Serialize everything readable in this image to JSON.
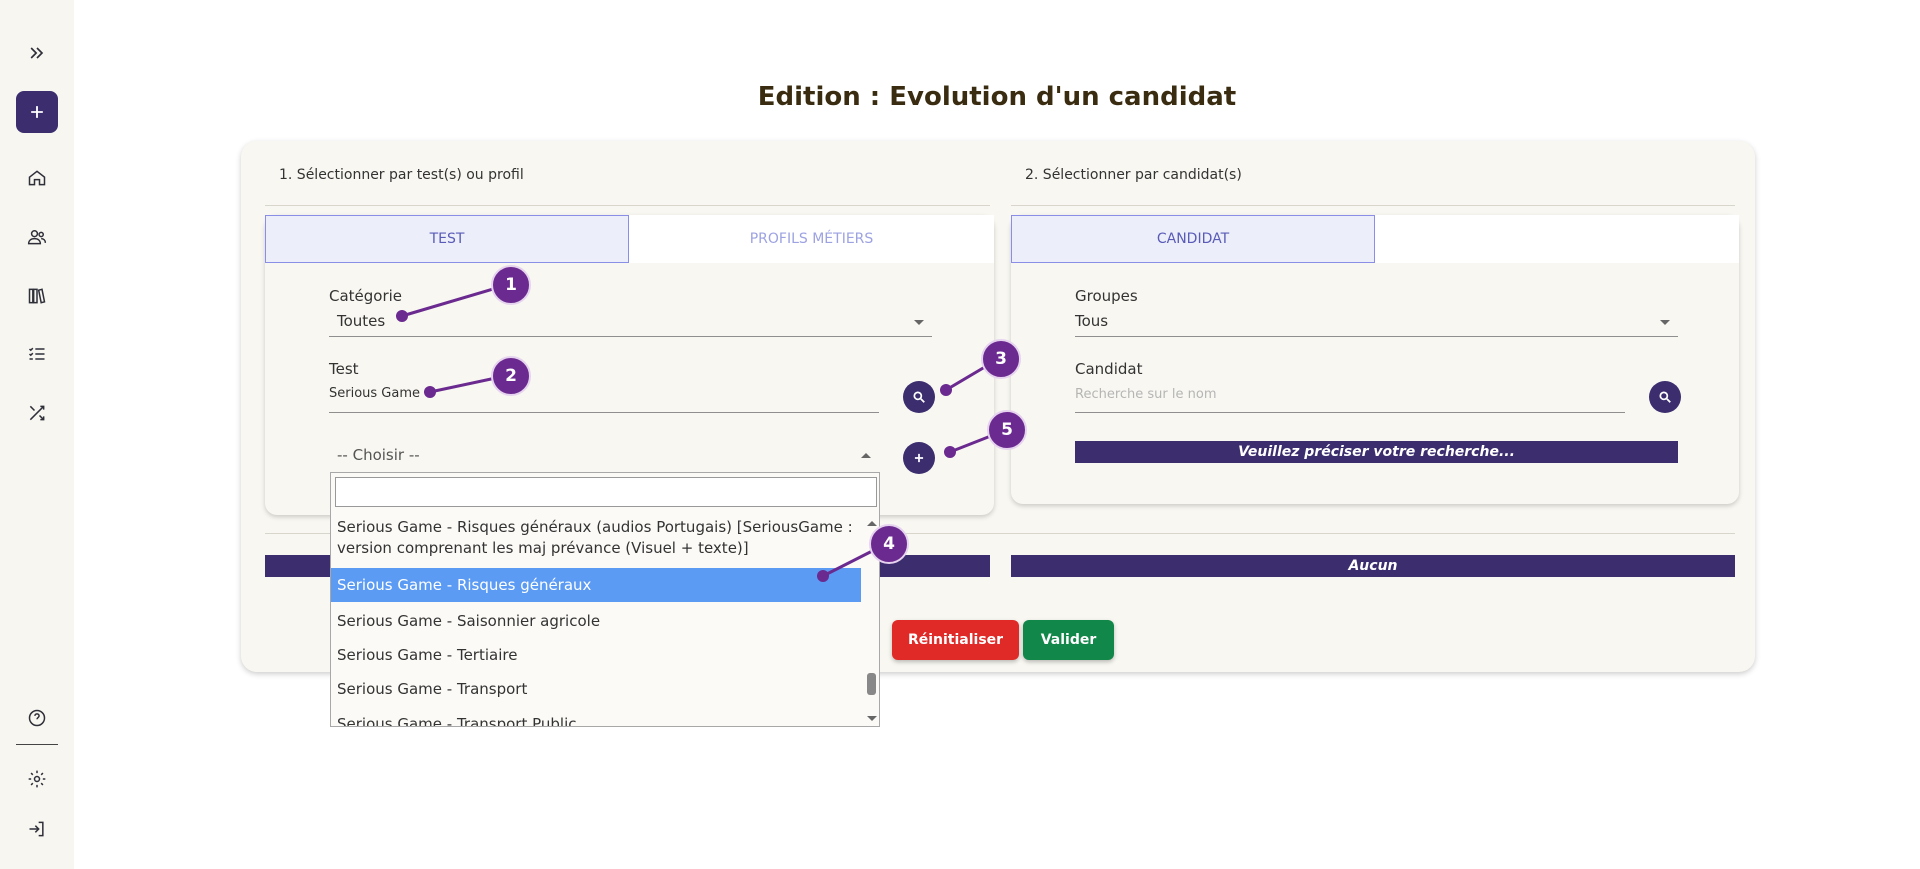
{
  "page": {
    "title": "Edition : Evolution d'un candidat"
  },
  "sidebar": {
    "items": [
      {
        "icon": "expand-icon"
      },
      {
        "icon": "plus-icon"
      },
      {
        "icon": "home-icon"
      },
      {
        "icon": "users-icon"
      },
      {
        "icon": "library-icon"
      },
      {
        "icon": "checklist-icon"
      },
      {
        "icon": "shuffle-icon"
      },
      {
        "icon": "help-icon"
      },
      {
        "icon": "settings-icon"
      },
      {
        "icon": "logout-icon"
      }
    ]
  },
  "left": {
    "section_title": "1. Sélectionner par test(s) ou profil",
    "tabs": [
      {
        "label": "TEST",
        "active": true
      },
      {
        "label": "PROFILS MÉTIERS",
        "active": false
      }
    ],
    "categorie": {
      "label": "Catégorie",
      "value": "Toutes"
    },
    "test": {
      "label": "Test",
      "value": "Serious Game"
    },
    "select": {
      "value": "-- Choisir --"
    },
    "dropdown": {
      "search_value": "",
      "items": [
        {
          "label": "Serious Game - Risques généraux (audios Portugais) [SeriousGame : version comprenant les maj prévance (Visuel + texte)]",
          "selected": false
        },
        {
          "label": "Serious Game - Risques généraux",
          "selected": true
        },
        {
          "label": "Serious Game - Saisonnier agricole",
          "selected": false
        },
        {
          "label": "Serious Game - Tertiaire",
          "selected": false
        },
        {
          "label": "Serious Game - Transport",
          "selected": false
        },
        {
          "label": "Serious Game - Transport Public",
          "selected": false
        }
      ]
    }
  },
  "right": {
    "section_title": "2. Sélectionner par candidat(s)",
    "tabs": [
      {
        "label": "CANDIDAT",
        "active": true
      }
    ],
    "groupes": {
      "label": "Groupes",
      "value": "Tous"
    },
    "candidat": {
      "label": "Candidat",
      "placeholder": "Recherche sur le nom"
    },
    "notice": "Veuillez préciser votre recherche..."
  },
  "bottom": {
    "right_bar": "Aucun",
    "reset_label": "Réinitialiser",
    "validate_label": "Valider"
  },
  "markers": [
    "1",
    "2",
    "3",
    "4",
    "5"
  ],
  "colors": {
    "primary": "#3b2d6e",
    "marker": "#6b2a8f",
    "reset": "#e02a28",
    "validate": "#12874a",
    "selected": "#5b9bf4"
  }
}
